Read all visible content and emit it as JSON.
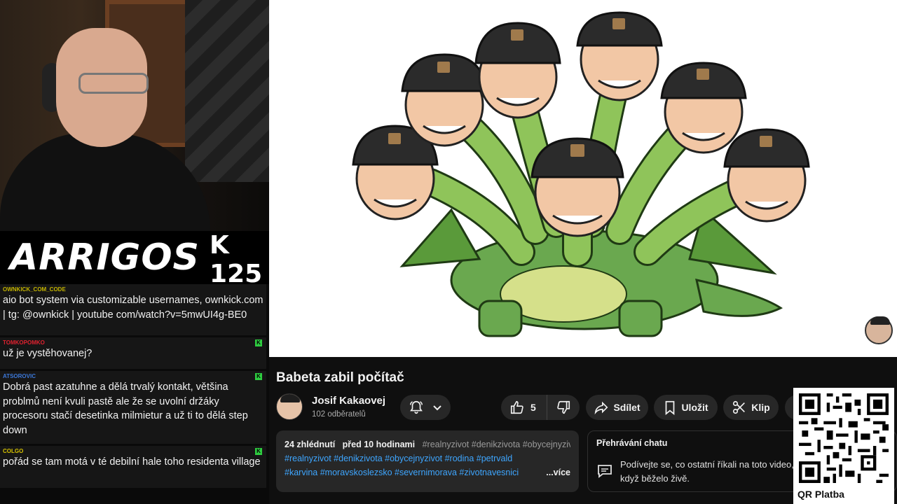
{
  "stream": {
    "brand_logo": "ARRIGOS",
    "episode": "K 125"
  },
  "chat": {
    "messages": [
      {
        "user": "OWNKICK_COM_CODE",
        "user_color": "#c4b400",
        "text": "aio bot system via customizable usernames, ownkick.com | tg: @ownkick | youtube com/watch?v=5mwUI4g-BE0"
      },
      {
        "user": "TOMKOPOMKO",
        "user_color": "#e0212f",
        "text": "už je vystěhovanej?"
      },
      {
        "user": "ATSOROVIC",
        "user_color": "#3c78d8",
        "text": "Dobrá past azatuhne a dělá trvalý kontakt, většina problmů není kvuli pastě ale že se uvolní držáky procesoru stačí desetinka milmietur a už ti to dělá step down"
      },
      {
        "user": "COLGO",
        "user_color": "#d6c200",
        "text": "pořád se tam motá v té debilní hale toho residenta village"
      }
    ],
    "kick_badge": "K"
  },
  "video": {
    "title": "Babeta zabil počítač",
    "channel_name": "Josif Kakaovej",
    "subscribers": "102 odběratelů",
    "like_count": "5",
    "share_label": "Sdílet",
    "save_label": "Uložit",
    "clip_label": "Klip"
  },
  "description": {
    "views": "24 zhlédnutí",
    "age": "před 10 hodinami",
    "inline_tags": "#realnyzivot #denikzivota #obycejnyzivot",
    "line2": "#realnyzivot #denikzivota  #obycejnyzivot #rodina  #petrvald",
    "line3": "#karvina #moravskoslezsko #severnimorava #zivotnavesnici",
    "more_label": "...více"
  },
  "chat_replay": {
    "title": "Přehrávání chatu",
    "text": "Podívejte se, co ostatní říkali na toto video, když běželo živě."
  },
  "qr": {
    "label": "QR Platba"
  },
  "colors": {
    "accent_link": "#3ea6ff",
    "pill_bg": "#272727",
    "kick_green": "#2ecc40"
  }
}
